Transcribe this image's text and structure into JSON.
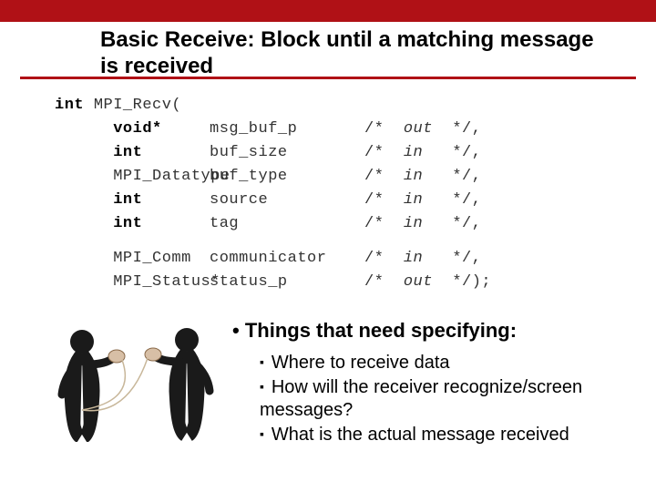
{
  "title": "Basic Receive: Block until a matching message is received",
  "code": {
    "fn_prefix": "int",
    "fn_name": "MPI_Recv(",
    "params": [
      {
        "type": "void*",
        "name": "msg_buf_p",
        "dir": "out",
        "tail": "*/,",
        "bold": true
      },
      {
        "type": "int",
        "name": "buf_size",
        "dir": "in",
        "tail": "*/,",
        "bold": true
      },
      {
        "type": "MPI_Datatype",
        "name": "buf_type",
        "dir": "in",
        "tail": "*/,",
        "bold": false
      },
      {
        "type": "int",
        "name": "source",
        "dir": "in",
        "tail": "*/,",
        "bold": true
      },
      {
        "type": "int",
        "name": "tag",
        "dir": "in",
        "tail": "*/,",
        "bold": true
      }
    ],
    "params2": [
      {
        "type": "MPI_Comm",
        "name": "communicator",
        "dir": "in",
        "tail": "*/,",
        "bold": false
      },
      {
        "type": "MPI_Status*",
        "name": "status_p",
        "dir": "out",
        "tail": "*/);",
        "bold": false
      }
    ]
  },
  "bullets": {
    "main": "Things that need specifying:",
    "subs": [
      "Where to receive data",
      "How will the receiver recognize/screen messages?",
      "What is the actual message received"
    ]
  }
}
